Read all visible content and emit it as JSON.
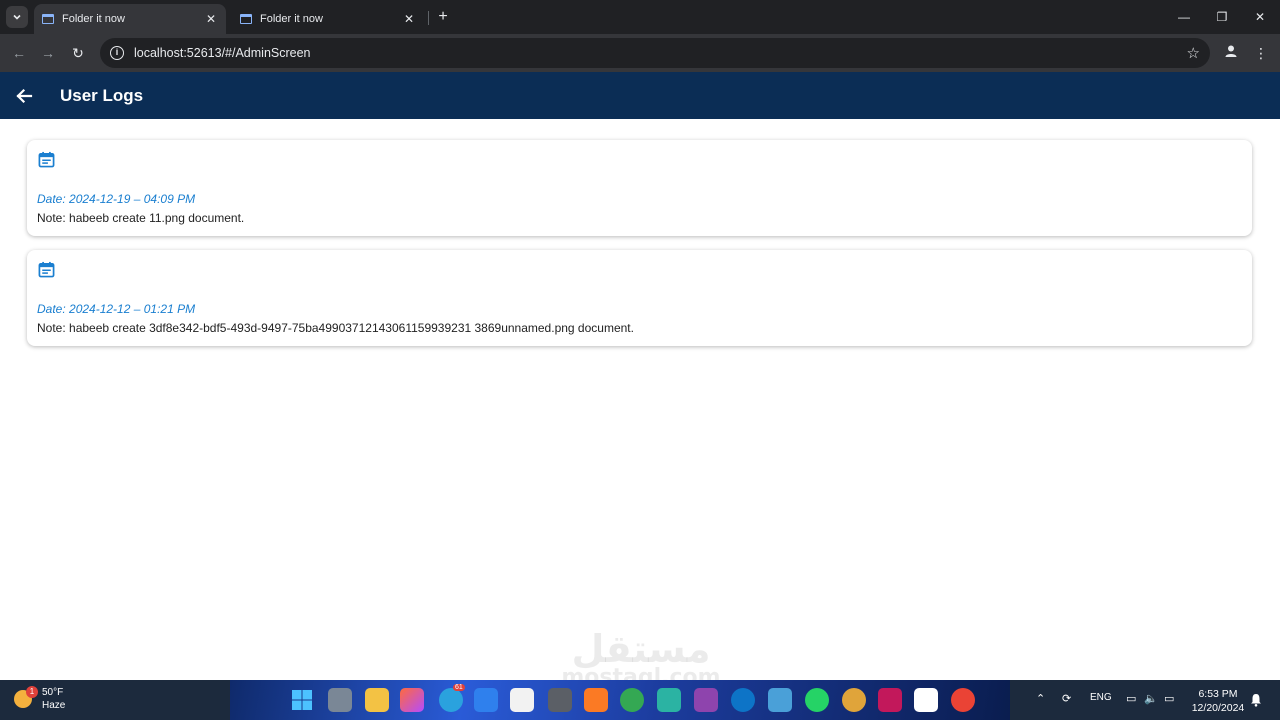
{
  "browser": {
    "tabs": [
      {
        "title": "Folder it now",
        "active": true
      },
      {
        "title": "Folder it now",
        "active": false
      }
    ],
    "new_tab_label": "+",
    "url": "localhost:52613/#/AdminScreen",
    "icons": {
      "back": "arrow-left-icon",
      "forward": "arrow-right-icon",
      "reload": "reload-icon",
      "info": "info-icon",
      "bookmark": "star-icon",
      "profile": "profile-icon",
      "menu": "more-vertical-icon"
    }
  },
  "appbar": {
    "title": "User Logs",
    "background": "#0b2d55"
  },
  "logs": [
    {
      "date": "Date: 2024-12-19 – 04:09 PM",
      "note": "Note: habeeb create 11.png document."
    },
    {
      "date": "Date: 2024-12-12 – 01:21 PM",
      "note": "Note: habeeb create 3df8e342-bdf5-493d-9497-75ba49903712143061159939231 3869unnamed.png document."
    }
  ],
  "colors": {
    "accent": "#1a7fd0",
    "note_text": "#222222"
  },
  "watermark": {
    "arabic": "مستقل",
    "latin": "mostaql.com"
  },
  "taskbar": {
    "weather": {
      "temp": "50°F",
      "condition": "Haze",
      "badge": "1"
    },
    "telegram_badge": "61",
    "language": "ENG",
    "time": "6:53 PM",
    "date": "12/20/2024"
  }
}
